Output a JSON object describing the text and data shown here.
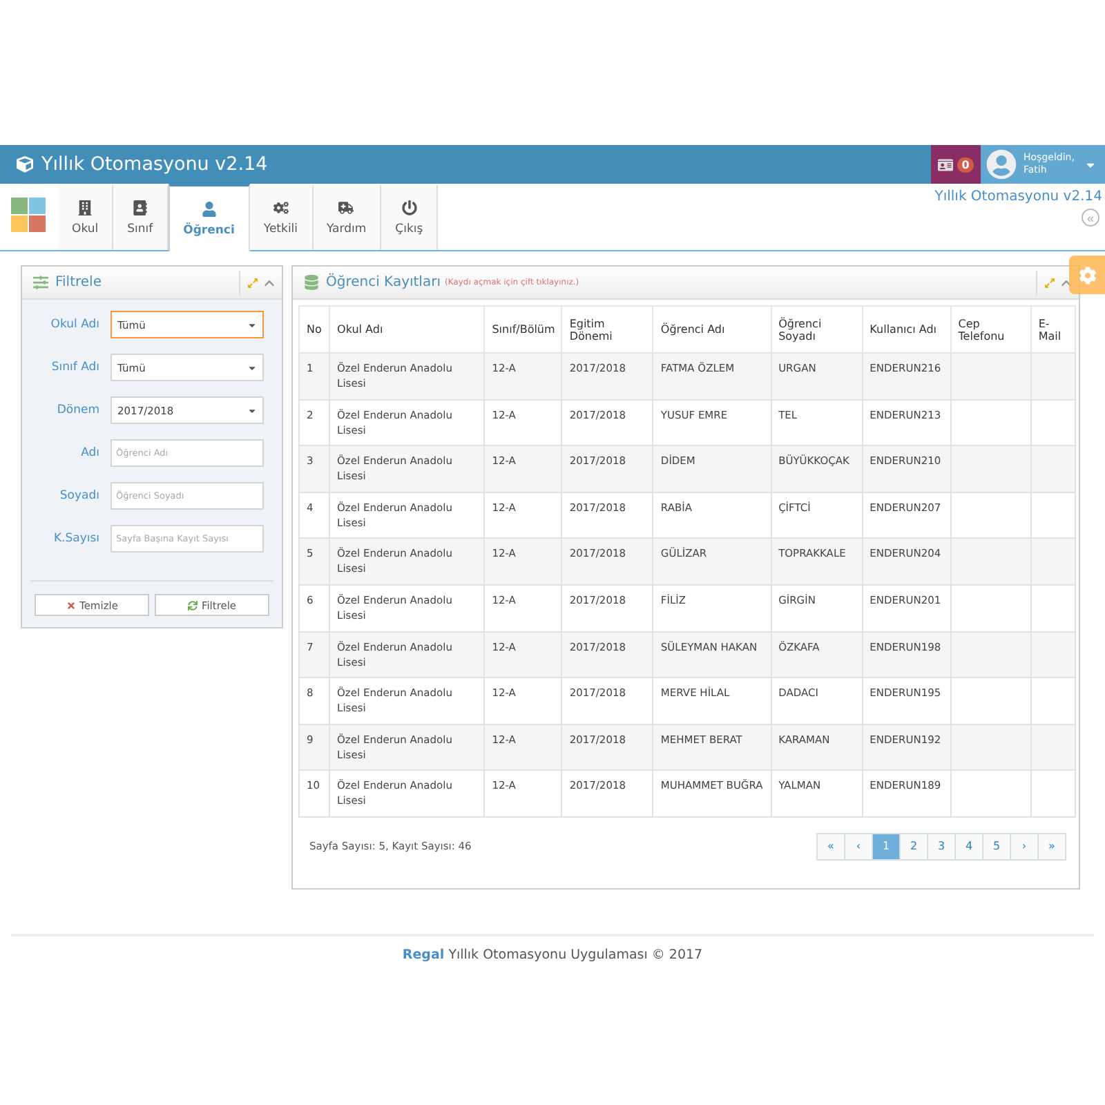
{
  "header": {
    "title": "Yıllık Otomasyonu v2.14",
    "notifications": "0",
    "greeting": "Hoşgeldin,",
    "user": "Fatih"
  },
  "toolbar": {
    "tabs": [
      {
        "label": "Okul",
        "kind": "building",
        "selected": false
      },
      {
        "label": "Sınıf",
        "kind": "contact",
        "selected": false
      },
      {
        "label": "Öğrenci",
        "kind": "user",
        "selected": true
      },
      {
        "label": "Yetkili",
        "kind": "gears",
        "selected": false
      },
      {
        "label": "Yardım",
        "kind": "ambulance",
        "selected": false
      },
      {
        "label": "Çıkış",
        "kind": "power",
        "selected": false
      }
    ],
    "app_name": "Yıllık Otomasyonu v2.14",
    "collapse": "«"
  },
  "filter": {
    "title": "Filtrele",
    "fields": [
      {
        "label": "Okul Adı",
        "kind": "select",
        "value": "Tümü",
        "focused": true
      },
      {
        "label": "Sınıf Adı",
        "kind": "select",
        "value": "Tümü",
        "focused": false
      },
      {
        "label": "Dönem",
        "kind": "select",
        "value": "2017/2018",
        "focused": false
      },
      {
        "label": "Adı",
        "kind": "text",
        "placeholder": "Öğrenci Adı",
        "focused": false
      },
      {
        "label": "Soyadı",
        "kind": "text",
        "placeholder": "Öğrenci Soyadı",
        "focused": false
      },
      {
        "label": "K.Sayısı",
        "kind": "text",
        "placeholder": "Sayfa Başına Kayıt Sayısı",
        "focused": false
      }
    ],
    "buttons": [
      {
        "label": "Temizle",
        "kind": "clear"
      },
      {
        "label": "Filtrele",
        "kind": "refresh"
      }
    ]
  },
  "records": {
    "title": "Öğrenci Kayıtları",
    "hint": "(Kaydı açmak için çift tıklayınız.)",
    "columns": [
      "No",
      "Okul Adı",
      "Sınıf/Bölüm",
      "Egitim Dönemi",
      "Öğrenci Adı",
      "Öğrenci Soyadı",
      "Kullanıcı Adı",
      "Cep Telefonu",
      "E-Mail"
    ],
    "rows": [
      [
        "1",
        "Özel Enderun Anadolu Lisesi",
        "12-A",
        "2017/2018",
        "FATMA ÖZLEM",
        "URGAN",
        "ENDERUN216"
      ],
      [
        "2",
        "Özel Enderun Anadolu Lisesi",
        "12-A",
        "2017/2018",
        "YUSUF EMRE",
        "TEL",
        "ENDERUN213"
      ],
      [
        "3",
        "Özel Enderun Anadolu Lisesi",
        "12-A",
        "2017/2018",
        "DİDEM",
        "BÜYÜKKOÇAK",
        "ENDERUN210"
      ],
      [
        "4",
        "Özel Enderun Anadolu Lisesi",
        "12-A",
        "2017/2018",
        "RABİA",
        "ÇİFTCİ",
        "ENDERUN207"
      ],
      [
        "5",
        "Özel Enderun Anadolu Lisesi",
        "12-A",
        "2017/2018",
        "GÜLİZAR",
        "TOPRAKKALE",
        "ENDERUN204"
      ],
      [
        "6",
        "Özel Enderun Anadolu Lisesi",
        "12-A",
        "2017/2018",
        "FİLİZ",
        "GİRGİN",
        "ENDERUN201"
      ],
      [
        "7",
        "Özel Enderun Anadolu Lisesi",
        "12-A",
        "2017/2018",
        "SÜLEYMAN HAKAN",
        "ÖZKAFA",
        "ENDERUN198"
      ],
      [
        "8",
        "Özel Enderun Anadolu Lisesi",
        "12-A",
        "2017/2018",
        "MERVE HİLAL",
        "DADACI",
        "ENDERUN195"
      ],
      [
        "9",
        "Özel Enderun Anadolu Lisesi",
        "12-A",
        "2017/2018",
        "MEHMET BERAT",
        "KARAMAN",
        "ENDERUN192"
      ],
      [
        "10",
        "Özel Enderun Anadolu Lisesi",
        "12-A",
        "2017/2018",
        "MUHAMMET BUĞRA",
        "YALMAN",
        "ENDERUN189"
      ]
    ],
    "summary": "Sayfa Sayısı: 5, Kayıt Sayısı: 46",
    "pages": [
      {
        "label": "«",
        "selected": false
      },
      {
        "label": "‹",
        "selected": false
      },
      {
        "label": "1",
        "selected": true
      },
      {
        "label": "2",
        "selected": false
      },
      {
        "label": "3",
        "selected": false
      },
      {
        "label": "4",
        "selected": false
      },
      {
        "label": "5",
        "selected": false
      },
      {
        "label": "›",
        "selected": false
      },
      {
        "label": "»",
        "selected": false
      }
    ]
  },
  "footer": {
    "brand": "Regal",
    "text": "Yıllık Otomasyonu Uygulaması © 2017"
  }
}
